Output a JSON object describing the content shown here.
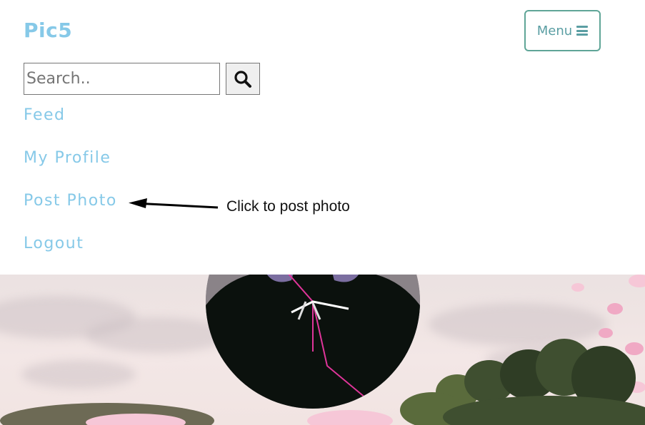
{
  "header": {
    "brand": "Pic5",
    "menu_label": "Menu",
    "menu_icon": "hamburger-icon"
  },
  "search": {
    "placeholder": "Search..",
    "value": "",
    "button_icon": "search-icon"
  },
  "nav": {
    "items": [
      {
        "label": "Feed"
      },
      {
        "label": "My Profile"
      },
      {
        "label": "Post Photo"
      },
      {
        "label": "Logout"
      }
    ]
  },
  "annotation": {
    "text": "Click to post photo"
  },
  "colors": {
    "brand": "#86c9e8",
    "menu_border": "#5fa597",
    "menu_text": "#5a9ea3"
  }
}
